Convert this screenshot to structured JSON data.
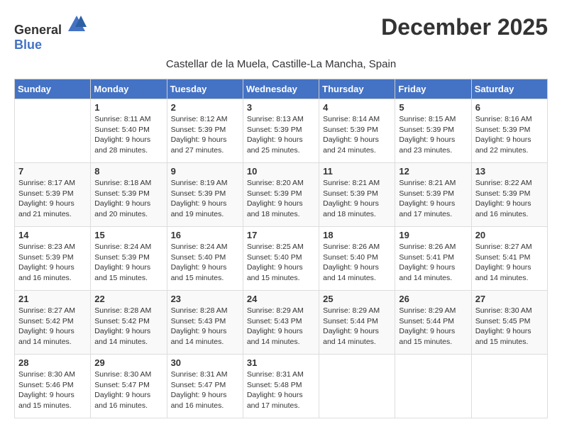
{
  "header": {
    "logo_general": "General",
    "logo_blue": "Blue",
    "month_year": "December 2025",
    "location": "Castellar de la Muela, Castille-La Mancha, Spain"
  },
  "columns": [
    "Sunday",
    "Monday",
    "Tuesday",
    "Wednesday",
    "Thursday",
    "Friday",
    "Saturday"
  ],
  "weeks": [
    [
      {
        "day": "",
        "sunrise": "",
        "sunset": "",
        "daylight": ""
      },
      {
        "day": "1",
        "sunrise": "Sunrise: 8:11 AM",
        "sunset": "Sunset: 5:40 PM",
        "daylight": "Daylight: 9 hours and 28 minutes."
      },
      {
        "day": "2",
        "sunrise": "Sunrise: 8:12 AM",
        "sunset": "Sunset: 5:39 PM",
        "daylight": "Daylight: 9 hours and 27 minutes."
      },
      {
        "day": "3",
        "sunrise": "Sunrise: 8:13 AM",
        "sunset": "Sunset: 5:39 PM",
        "daylight": "Daylight: 9 hours and 25 minutes."
      },
      {
        "day": "4",
        "sunrise": "Sunrise: 8:14 AM",
        "sunset": "Sunset: 5:39 PM",
        "daylight": "Daylight: 9 hours and 24 minutes."
      },
      {
        "day": "5",
        "sunrise": "Sunrise: 8:15 AM",
        "sunset": "Sunset: 5:39 PM",
        "daylight": "Daylight: 9 hours and 23 minutes."
      },
      {
        "day": "6",
        "sunrise": "Sunrise: 8:16 AM",
        "sunset": "Sunset: 5:39 PM",
        "daylight": "Daylight: 9 hours and 22 minutes."
      }
    ],
    [
      {
        "day": "7",
        "sunrise": "Sunrise: 8:17 AM",
        "sunset": "Sunset: 5:39 PM",
        "daylight": "Daylight: 9 hours and 21 minutes."
      },
      {
        "day": "8",
        "sunrise": "Sunrise: 8:18 AM",
        "sunset": "Sunset: 5:39 PM",
        "daylight": "Daylight: 9 hours and 20 minutes."
      },
      {
        "day": "9",
        "sunrise": "Sunrise: 8:19 AM",
        "sunset": "Sunset: 5:39 PM",
        "daylight": "Daylight: 9 hours and 19 minutes."
      },
      {
        "day": "10",
        "sunrise": "Sunrise: 8:20 AM",
        "sunset": "Sunset: 5:39 PM",
        "daylight": "Daylight: 9 hours and 18 minutes."
      },
      {
        "day": "11",
        "sunrise": "Sunrise: 8:21 AM",
        "sunset": "Sunset: 5:39 PM",
        "daylight": "Daylight: 9 hours and 18 minutes."
      },
      {
        "day": "12",
        "sunrise": "Sunrise: 8:21 AM",
        "sunset": "Sunset: 5:39 PM",
        "daylight": "Daylight: 9 hours and 17 minutes."
      },
      {
        "day": "13",
        "sunrise": "Sunrise: 8:22 AM",
        "sunset": "Sunset: 5:39 PM",
        "daylight": "Daylight: 9 hours and 16 minutes."
      }
    ],
    [
      {
        "day": "14",
        "sunrise": "Sunrise: 8:23 AM",
        "sunset": "Sunset: 5:39 PM",
        "daylight": "Daylight: 9 hours and 16 minutes."
      },
      {
        "day": "15",
        "sunrise": "Sunrise: 8:24 AM",
        "sunset": "Sunset: 5:39 PM",
        "daylight": "Daylight: 9 hours and 15 minutes."
      },
      {
        "day": "16",
        "sunrise": "Sunrise: 8:24 AM",
        "sunset": "Sunset: 5:40 PM",
        "daylight": "Daylight: 9 hours and 15 minutes."
      },
      {
        "day": "17",
        "sunrise": "Sunrise: 8:25 AM",
        "sunset": "Sunset: 5:40 PM",
        "daylight": "Daylight: 9 hours and 15 minutes."
      },
      {
        "day": "18",
        "sunrise": "Sunrise: 8:26 AM",
        "sunset": "Sunset: 5:40 PM",
        "daylight": "Daylight: 9 hours and 14 minutes."
      },
      {
        "day": "19",
        "sunrise": "Sunrise: 8:26 AM",
        "sunset": "Sunset: 5:41 PM",
        "daylight": "Daylight: 9 hours and 14 minutes."
      },
      {
        "day": "20",
        "sunrise": "Sunrise: 8:27 AM",
        "sunset": "Sunset: 5:41 PM",
        "daylight": "Daylight: 9 hours and 14 minutes."
      }
    ],
    [
      {
        "day": "21",
        "sunrise": "Sunrise: 8:27 AM",
        "sunset": "Sunset: 5:42 PM",
        "daylight": "Daylight: 9 hours and 14 minutes."
      },
      {
        "day": "22",
        "sunrise": "Sunrise: 8:28 AM",
        "sunset": "Sunset: 5:42 PM",
        "daylight": "Daylight: 9 hours and 14 minutes."
      },
      {
        "day": "23",
        "sunrise": "Sunrise: 8:28 AM",
        "sunset": "Sunset: 5:43 PM",
        "daylight": "Daylight: 9 hours and 14 minutes."
      },
      {
        "day": "24",
        "sunrise": "Sunrise: 8:29 AM",
        "sunset": "Sunset: 5:43 PM",
        "daylight": "Daylight: 9 hours and 14 minutes."
      },
      {
        "day": "25",
        "sunrise": "Sunrise: 8:29 AM",
        "sunset": "Sunset: 5:44 PM",
        "daylight": "Daylight: 9 hours and 14 minutes."
      },
      {
        "day": "26",
        "sunrise": "Sunrise: 8:29 AM",
        "sunset": "Sunset: 5:44 PM",
        "daylight": "Daylight: 9 hours and 15 minutes."
      },
      {
        "day": "27",
        "sunrise": "Sunrise: 8:30 AM",
        "sunset": "Sunset: 5:45 PM",
        "daylight": "Daylight: 9 hours and 15 minutes."
      }
    ],
    [
      {
        "day": "28",
        "sunrise": "Sunrise: 8:30 AM",
        "sunset": "Sunset: 5:46 PM",
        "daylight": "Daylight: 9 hours and 15 minutes."
      },
      {
        "day": "29",
        "sunrise": "Sunrise: 8:30 AM",
        "sunset": "Sunset: 5:47 PM",
        "daylight": "Daylight: 9 hours and 16 minutes."
      },
      {
        "day": "30",
        "sunrise": "Sunrise: 8:31 AM",
        "sunset": "Sunset: 5:47 PM",
        "daylight": "Daylight: 9 hours and 16 minutes."
      },
      {
        "day": "31",
        "sunrise": "Sunrise: 8:31 AM",
        "sunset": "Sunset: 5:48 PM",
        "daylight": "Daylight: 9 hours and 17 minutes."
      },
      {
        "day": "",
        "sunrise": "",
        "sunset": "",
        "daylight": ""
      },
      {
        "day": "",
        "sunrise": "",
        "sunset": "",
        "daylight": ""
      },
      {
        "day": "",
        "sunrise": "",
        "sunset": "",
        "daylight": ""
      }
    ]
  ]
}
